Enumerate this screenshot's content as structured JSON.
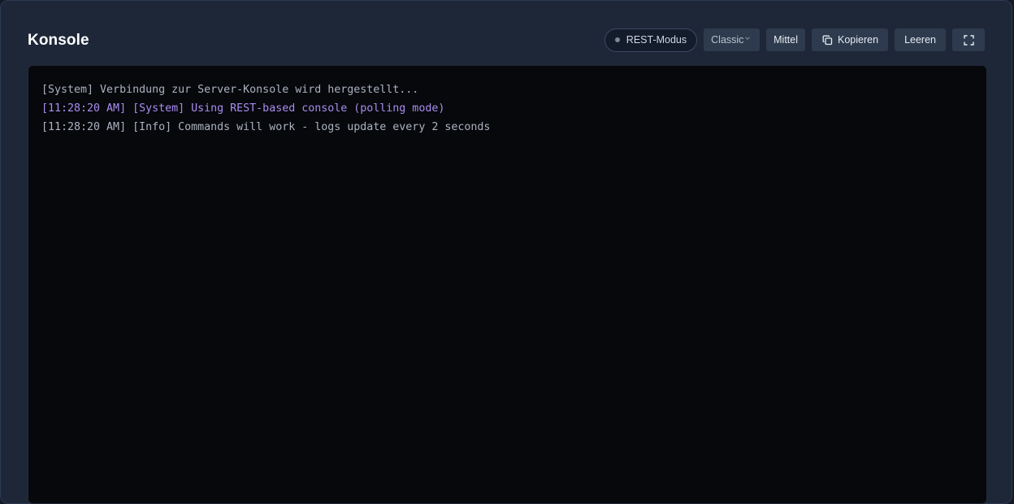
{
  "panel": {
    "title": "Konsole"
  },
  "toolbar": {
    "mode_label": "REST-Modus",
    "theme_select": "Classic",
    "size_label": "Mittel",
    "copy_label": "Kopieren",
    "clear_label": "Leeren"
  },
  "icons": {
    "mode": "status-dot-icon",
    "select": "chevron-down-icon",
    "copy": "copy-icon",
    "fullscreen": "fullscreen-icon"
  },
  "colors": {
    "system_line": "#a98cf0",
    "plain_line": "#aab2bf",
    "console_bg": "#07080c",
    "panel_bg": "#1d2738"
  },
  "console": {
    "lines": [
      {
        "text": "[System] Verbindung zur Server-Konsole wird hergestellt...",
        "kind": "plain"
      },
      {
        "text": "[11:28:20 AM] [System] Using REST-based console (polling mode)",
        "kind": "system"
      },
      {
        "text": "[11:28:20 AM] [Info] Commands will work - logs update every 2 seconds",
        "kind": "plain"
      }
    ]
  }
}
